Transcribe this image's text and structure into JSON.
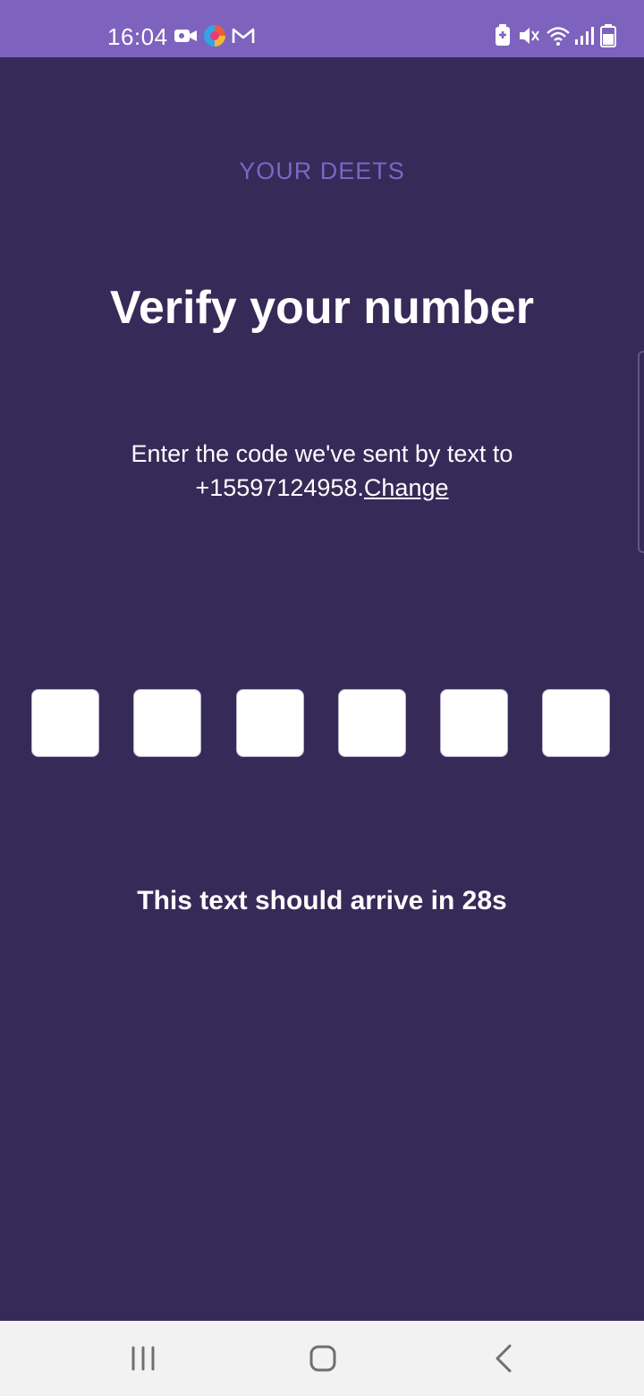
{
  "status_bar": {
    "time": "16:04",
    "background": "#7d63bd",
    "left_icons": [
      "video-camera-icon",
      "browser-app-icon",
      "gmail-icon"
    ],
    "right_icons": [
      "battery-saver-icon",
      "mute-icon",
      "wifi-icon",
      "signal-icon",
      "battery-icon"
    ]
  },
  "header": {
    "section_label": "YOUR DEETS"
  },
  "main": {
    "title": "Verify your number",
    "instruction_text": "Enter the code we've sent by text to +15597124958.",
    "change_link": "Change",
    "code_digit_count": 6,
    "countdown_text": "This text should arrive in 28s"
  },
  "nav_bar": {
    "buttons": [
      "recent-apps-icon",
      "home-icon",
      "back-icon"
    ]
  },
  "colors": {
    "background": "#352a58",
    "accent": "#7b67c4",
    "text": "#ffffff",
    "code_box": "#ffffff"
  }
}
